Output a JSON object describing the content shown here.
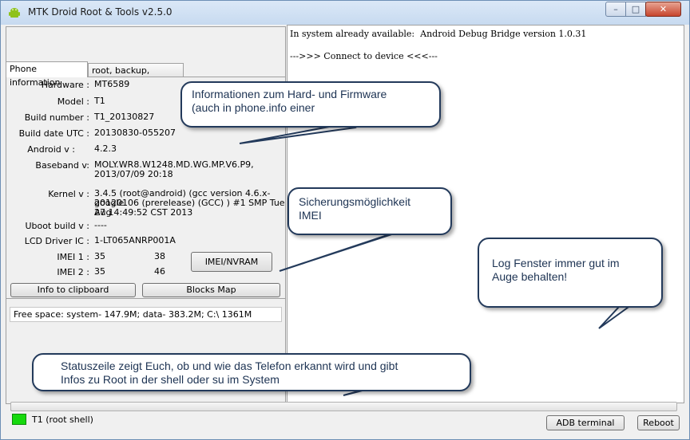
{
  "window": {
    "title": "MTK Droid Root & Tools v2.5.0",
    "controls": {
      "minimize": "–",
      "maximize": "□",
      "close": "✕"
    }
  },
  "tabs": [
    {
      "label": "Phone information"
    },
    {
      "label": "root, backup, recovery"
    }
  ],
  "phone_info": {
    "hardware": {
      "label": "Hardware :",
      "value": "MT6589"
    },
    "model": {
      "label": "Model :",
      "value": "T1"
    },
    "build_number": {
      "label": "Build number :",
      "value": "T1_20130827"
    },
    "build_date": {
      "label": "Build date UTC :",
      "value": "20130830-055207"
    },
    "android": {
      "label": "Android  v :",
      "value": "4.2.3"
    },
    "baseband": {
      "label": "Baseband v:",
      "value_line1": "MOLY.WR8.W1248.MD.WG.MP.V6.P9,",
      "value_line2": "2013/07/09 20:18"
    },
    "kernel": {
      "label": "Kernel v :",
      "value_line1": "3.4.5 (root@android) (gcc version 4.6.x-google",
      "value_line2": "20120106 (prerelease) (GCC) ) #1 SMP  Tue Aug",
      "value_line3": "27 14:49:52 CST 2013"
    },
    "uboot": {
      "label": "Uboot build v :",
      "value": "----"
    },
    "lcd": {
      "label": "LCD Driver IC :",
      "value": "1-LT065ANRP001A"
    },
    "imei1": {
      "label": "IMEI 1 :",
      "value_a": "35",
      "value_b": "38"
    },
    "imei2": {
      "label": "IMEI 2 :",
      "value_a": "35",
      "value_b": "46"
    }
  },
  "buttons": {
    "imei_nvram": "IMEI/NVRAM",
    "info_clipboard": "Info to clipboard",
    "blocks_map": "Blocks Map",
    "adb_terminal": "ADB terminal",
    "reboot": "Reboot"
  },
  "free_space": "Free space: system- 147.9M; data- 383.2M;  C:\\ 1361M",
  "log": {
    "line1": "In system already available:  Android Debug Bridge version 1.0.31",
    "line2": "--->>> Connect to device <<<---"
  },
  "status": {
    "text": "T1 (root shell)",
    "led_color": "#16d90d"
  },
  "callouts": {
    "hardware_info": {
      "line1": "Informationen zum Hard- und Firmware",
      "line2": "(auch in phone.info einer"
    },
    "imei_backup": {
      "line1": "Sicherungsmöglichkeit",
      "line2": "IMEI"
    },
    "log_window": {
      "line1": "Log Fenster immer gut im",
      "line2": "Auge behalten!"
    },
    "status_line": {
      "line1": "Statuszeile zeigt Euch, ob und wie das Telefon erkannt wird und gibt",
      "line2": "Infos zu Root in der shell oder su im System"
    }
  }
}
